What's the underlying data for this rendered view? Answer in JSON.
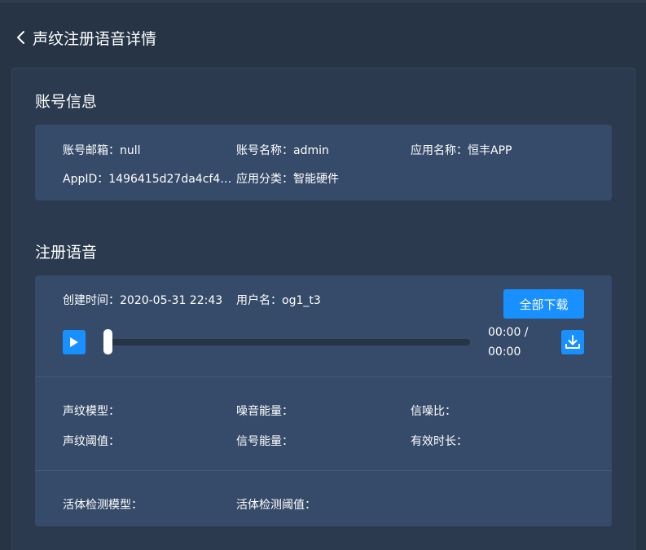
{
  "header": {
    "title": "声纹注册语音详情",
    "back_icon": "chevron-left-icon"
  },
  "account_section": {
    "title": "账号信息",
    "fields": [
      {
        "label": "账号邮箱：",
        "value": "null"
      },
      {
        "label": "账号名称：",
        "value": "admin"
      },
      {
        "label": "应用名称：",
        "value": "恒丰APP"
      },
      {
        "label": "AppID：",
        "value": "1496415d27da4cf49..."
      },
      {
        "label": "应用分类：",
        "value": "智能硬件"
      }
    ]
  },
  "voice_section": {
    "title": "注册语音",
    "created_label": "创建时间：",
    "created_value": "2020-05-31 22:43",
    "user_label": "用户名：",
    "user_value": "og1_t3",
    "download_all_label": "全部下载",
    "player": {
      "current_time": "00:00 /",
      "total_time": "00:00",
      "progress": 0,
      "play_icon": "play-icon",
      "download_icon": "download-icon"
    },
    "metrics": [
      {
        "label": "声纹模型：",
        "value": ""
      },
      {
        "label": "噪音能量：",
        "value": ""
      },
      {
        "label": "信噪比：",
        "value": ""
      },
      {
        "label": "声纹阈值：",
        "value": ""
      },
      {
        "label": "信号能量：",
        "value": ""
      },
      {
        "label": "有效时长：",
        "value": ""
      }
    ],
    "liveness": [
      {
        "label": "活体检测模型：",
        "value": ""
      },
      {
        "label": "活体检测阈值：",
        "value": ""
      }
    ]
  },
  "colors": {
    "background": "#263446",
    "panel": "#2b3a4f",
    "card": "#364b69",
    "accent": "#1890ff"
  }
}
